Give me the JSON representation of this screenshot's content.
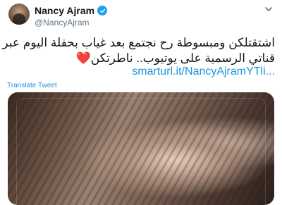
{
  "author": {
    "display_name": "Nancy Ajram",
    "handle": "@NancyAjram",
    "verified_icon": "verified-badge-icon",
    "avatar_icon": "profile-photo"
  },
  "tweet": {
    "text_line1": "اشتقتلكن ومبسوطة رح نجتمع بعد غياب بحفلة اليوم عبر",
    "text_line2": "قناتي الرسمية على يوتيوب.. ناطرتكن",
    "heart": "❤️",
    "link": "smarturl.it/NancyAjramYTli...",
    "translate_label": "Translate Tweet"
  },
  "colors": {
    "link": "#1b95e0",
    "verified": "#1da1f2",
    "heart": "#e0245e"
  },
  "menu_icon": "chevron-down-icon"
}
